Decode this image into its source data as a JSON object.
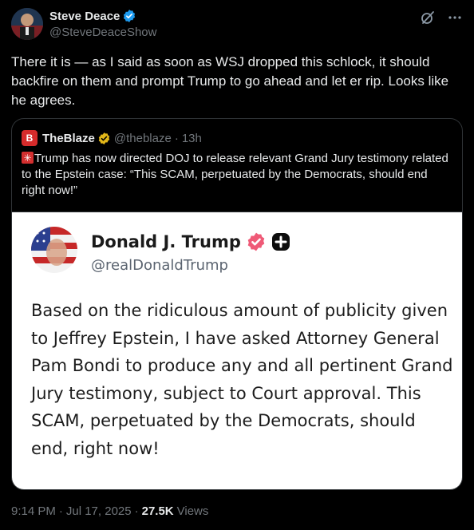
{
  "author": {
    "name": "Steve Deace",
    "handle": "@SteveDeaceShow"
  },
  "tweet_text": "There it is — as I said as soon as WSJ dropped this schlock, it should backfire on them and prompt Trump to go ahead and let er rip. Looks like he agrees.",
  "quote": {
    "name": "TheBlaze",
    "handle": "@theblaze",
    "dot": "·",
    "time": "13h",
    "avatar_letter": "B",
    "text": "Trump has now directed DOJ to release relevant Grand Jury testimony related to the Epstein case:  “This SCAM, perpetuated by the Democrats, should end right now!”",
    "media": {
      "name": "Donald J. Trump",
      "handle": "@realDonaldTrump",
      "body": "Based on the ridiculous amount of publicity given to Jeffrey Epstein, I have asked Attorney General Pam Bondi to produce any and all pertinent Grand Jury testimony, subject to Court approval. This SCAM, perpetuated by the Democrats, should end, right now!"
    }
  },
  "meta": {
    "time": "9:14 PM",
    "sep1": "·",
    "date": "Jul 17, 2025",
    "sep2": "·",
    "views_count": "27.5K",
    "views_label": "Views"
  },
  "icons": {
    "verified": "verified-badge-icon",
    "grok": "grok-icon",
    "more": "more-icon",
    "siren": "siren-icon",
    "truth_verified": "truth-verified-icon",
    "truth_plus": "plus-icon"
  },
  "colors": {
    "background": "#000000",
    "text": "#e7e9ea",
    "muted": "#71767b",
    "verified_blue": "#1d9bf0",
    "gold_badge": "#e2b719",
    "blaze_red": "#d62b2b",
    "truth_badge": "#ef5a77"
  }
}
